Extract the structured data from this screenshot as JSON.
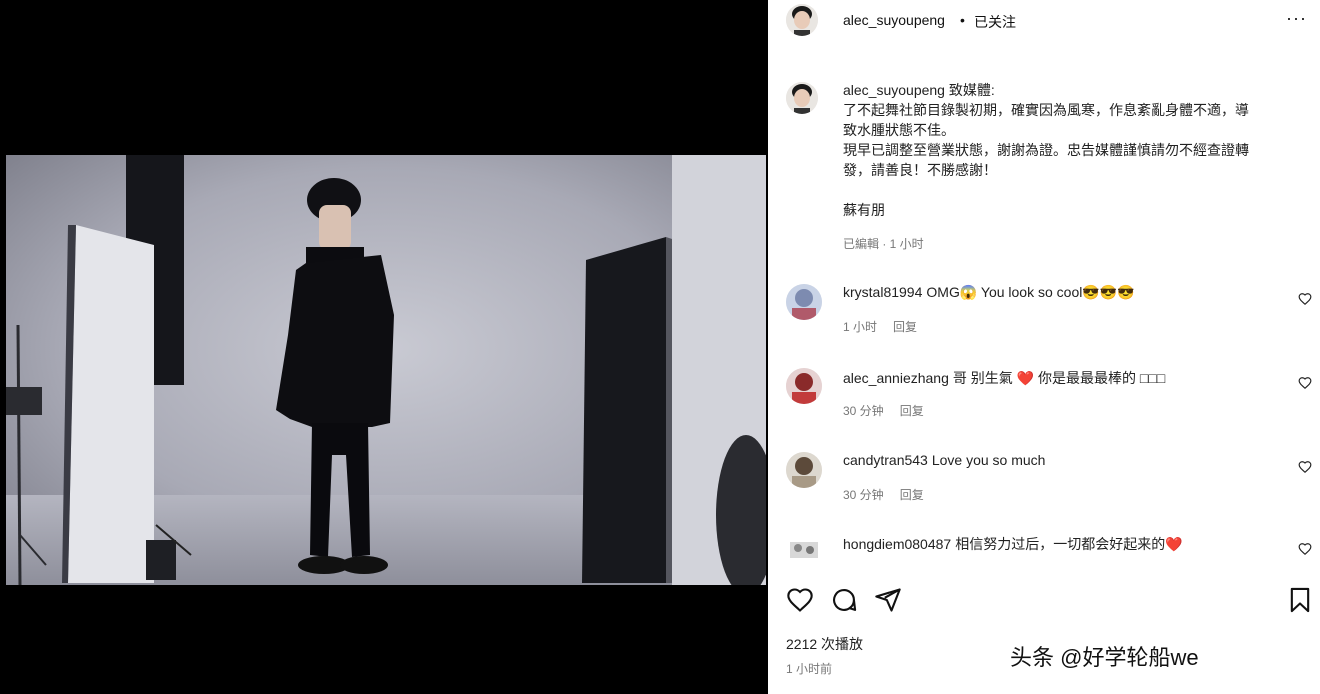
{
  "post": {
    "username": "alec_suyoupeng",
    "separator": "•",
    "follow_status": "已关注",
    "more": "···"
  },
  "caption": {
    "username": "alec_suyoupeng",
    "lines": [
      "致媒體:",
      "了不起舞社節目錄製初期，確實因為風寒，作息紊亂身體不適，導",
      "致水腫狀態不佳。",
      "現早已調整至營業狀態，謝謝為證。忠告媒體謹慎請勿不經查證轉",
      "發，請善良！不勝感謝！",
      "",
      "蘇有朋"
    ],
    "meta": "已編輯 · 1 小时"
  },
  "comments": [
    {
      "user": "krystal81994",
      "text": "OMG😱 You look so cool😎😎😎",
      "time": "1 小时",
      "reply": "回复"
    },
    {
      "user": "alec_anniezhang",
      "text": "哥 别生氣 ❤️ 你是最最最棒的 □□□",
      "time": "30 分钟",
      "reply": "回复"
    },
    {
      "user": "candytran543",
      "text": "Love you so much",
      "time": "30 分钟",
      "reply": "回复"
    },
    {
      "user": "hongdiem080487",
      "text": "相信努力过后，一切都会好起来的❤️",
      "time": "",
      "reply": ""
    }
  ],
  "stats": {
    "views": "2212 次播放",
    "post_time": "1 小时前"
  },
  "watermark": "头条 @好学轮船we",
  "colors": {
    "panel_bg": "#ffffff",
    "like_red": "#e0245e",
    "text_secondary": "#777777"
  }
}
